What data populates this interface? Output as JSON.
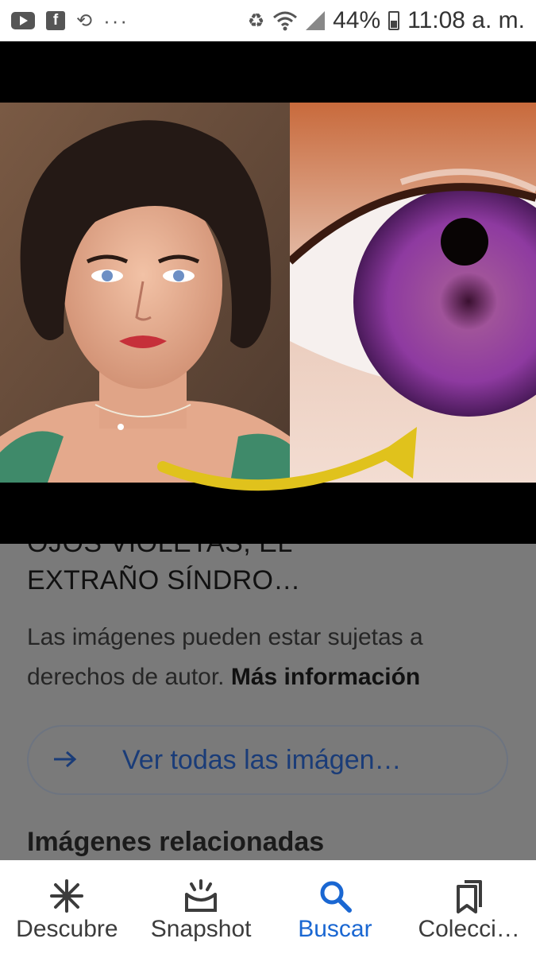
{
  "status_bar": {
    "battery": "44%",
    "time": "11:08 a. m.",
    "overflow": "···"
  },
  "result": {
    "title_cut": "OJOS VIOLETAS, EL",
    "title": "EXTRAÑO SÍNDRO…",
    "rights_text": "Las imágenes pueden estar sujetas a derechos de autor.",
    "rights_link": "Más información",
    "see_all": "Ver todas las imágen…",
    "related_heading": "Imágenes relacionadas"
  },
  "bottom_nav": {
    "items": [
      {
        "label": "Descubre",
        "icon": "asterisk-icon"
      },
      {
        "label": "Snapshot",
        "icon": "snapshot-tray-icon"
      },
      {
        "label": "Buscar",
        "icon": "search-icon",
        "active": true
      },
      {
        "label": "Colecci…",
        "icon": "bookmarks-icon"
      }
    ]
  },
  "colors": {
    "accent": "#1a67d2",
    "link_text": "#1a3c78",
    "scrim": "#7a7a7a"
  }
}
